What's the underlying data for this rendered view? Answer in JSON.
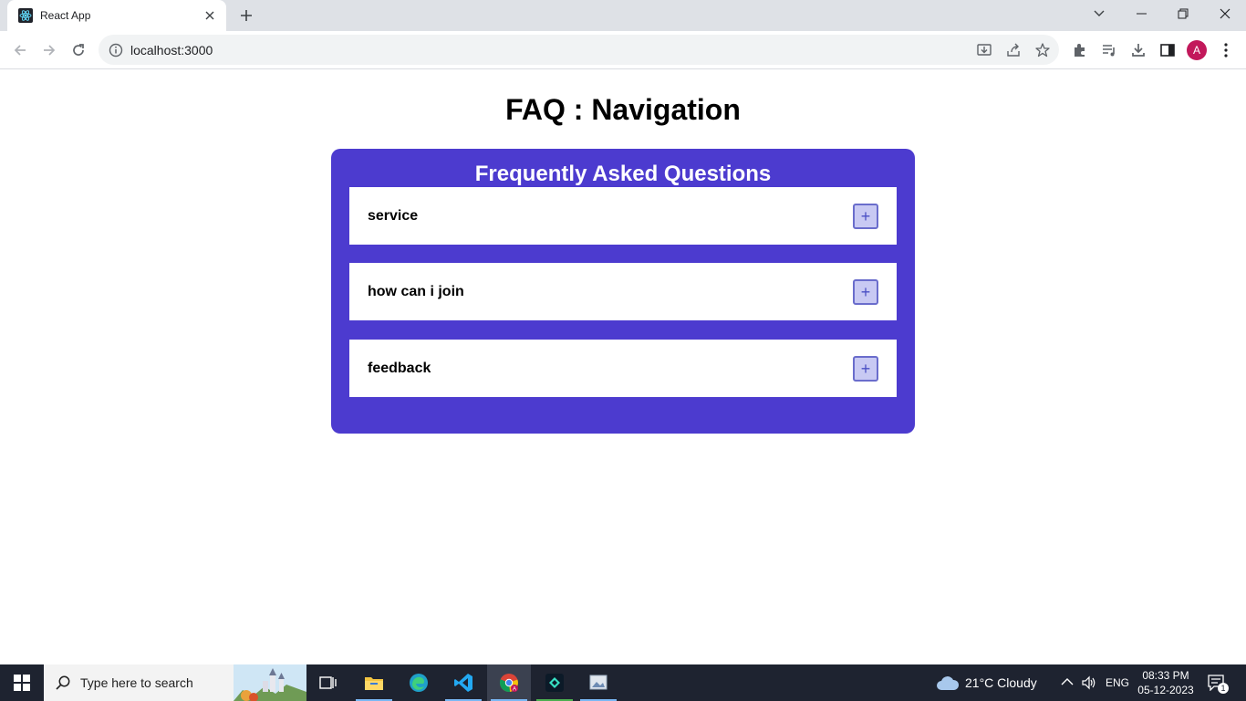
{
  "browser": {
    "tab_title": "React App",
    "url": "localhost:3000",
    "profile_initial": "A"
  },
  "page": {
    "title": "FAQ : Navigation",
    "faq_heading": "Frequently Asked Questions",
    "faq_items": [
      {
        "question": "service",
        "toggle": "+"
      },
      {
        "question": "how can i join",
        "toggle": "+"
      },
      {
        "question": "feedback",
        "toggle": "+"
      }
    ],
    "colors": {
      "card_background": "#4c3bcf",
      "toggle_background": "#c8c9f3",
      "toggle_border": "#6a6dcc"
    }
  },
  "taskbar": {
    "search_placeholder": "Type here to search",
    "weather": "21°C  Cloudy",
    "language": "ENG",
    "time": "08:33 PM",
    "date": "05-12-2023",
    "notification_count": "1",
    "apps": [
      "task-view-icon",
      "file-explorer-icon",
      "edge-icon",
      "vscode-icon",
      "chrome-icon",
      "filmora-icon",
      "photos-icon"
    ]
  }
}
